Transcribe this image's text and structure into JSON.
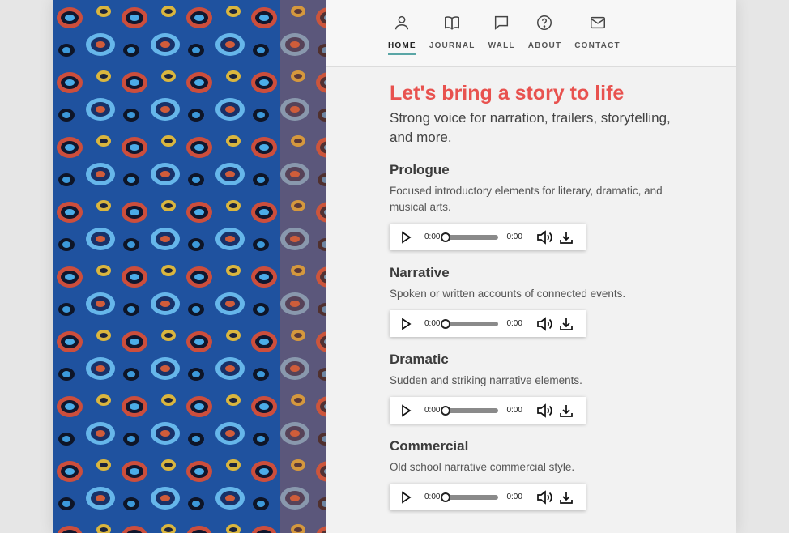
{
  "nav": {
    "items": [
      {
        "label": "HOME",
        "icon": "person-icon",
        "active": true
      },
      {
        "label": "JOURNAL",
        "icon": "book-icon"
      },
      {
        "label": "WALL",
        "icon": "chat-bubble-icon"
      },
      {
        "label": "ABOUT",
        "icon": "question-circle-icon"
      },
      {
        "label": "CONTACT",
        "icon": "envelope-icon"
      }
    ]
  },
  "hero": {
    "headline": "Let's bring a story to life",
    "subhead": "Strong voice for narration, trailers, storytelling, and more."
  },
  "tracks": [
    {
      "title": "Prologue",
      "description": "Focused introductory elements for literary, dramatic, and musical arts.",
      "current_time": "0:00",
      "duration": "0:00"
    },
    {
      "title": "Narrative",
      "description": "Spoken or written accounts of connected events.",
      "current_time": "0:00",
      "duration": "0:00"
    },
    {
      "title": "Dramatic",
      "description": "Sudden and striking narrative elements.",
      "current_time": "0:00",
      "duration": "0:00"
    },
    {
      "title": "Commercial",
      "description": "Old school narrative commercial style.",
      "current_time": "0:00",
      "duration": "0:00"
    }
  ],
  "colors": {
    "accent": "#e8524f",
    "nav_underline": "#5aa6a6",
    "panel_bg": "#f2f2f2"
  }
}
